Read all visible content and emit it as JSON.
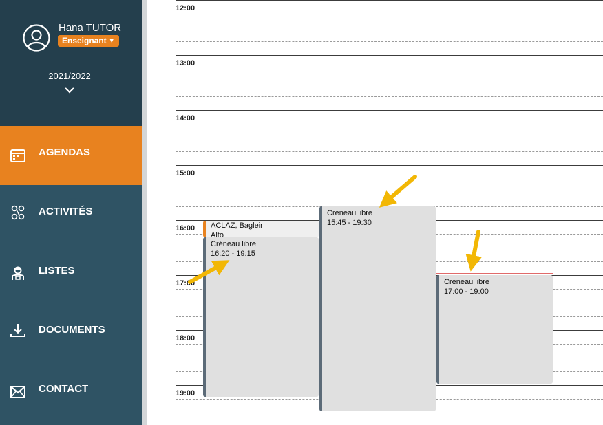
{
  "user": {
    "name": "Hana TUTOR",
    "role": "Enseignant"
  },
  "school_year": "2021/2022",
  "nav": [
    {
      "label": "AGENDAS",
      "icon": "calendar-icon",
      "active": true
    },
    {
      "label": "ACTIVITÉS",
      "icon": "activities-icon",
      "active": false
    },
    {
      "label": "LISTES",
      "icon": "student-icon",
      "active": false
    },
    {
      "label": "DOCUMENTS",
      "icon": "download-icon",
      "active": false
    },
    {
      "label": "CONTACT",
      "icon": "envelope-icon",
      "active": false
    }
  ],
  "hours": [
    "12:00",
    "13:00",
    "14:00",
    "15:00",
    "16:00",
    "17:00",
    "18:00",
    "19:00"
  ],
  "events": [
    {
      "line1": "ACLAZ, Bagleir",
      "line2": "Alto"
    },
    {
      "line1": "Créneau libre",
      "line2": "16:20 - 19:15"
    },
    {
      "line1": "Créneau libre",
      "line2": "15:45 - 19:30"
    },
    {
      "line1": "Créneau libre",
      "line2": "17:00 - 19:00"
    }
  ],
  "colors": {
    "accent": "#e8821f",
    "sidebar": "#2f5364",
    "sidebar_top": "#243f4d",
    "annotation_arrow": "#f2b705"
  }
}
